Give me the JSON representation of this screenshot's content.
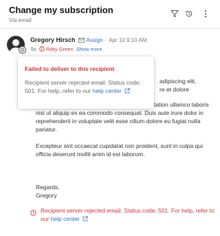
{
  "header": {
    "title": "Change my subscription",
    "subtitle": "Via email"
  },
  "message": {
    "sender": "Gregory Hirsch",
    "assign_label": "Assign",
    "separator": "·",
    "date": "Apr 10 9:10 AM",
    "to_label": "To:",
    "recipient": "Riley Green",
    "show_more": "Show more",
    "para1": "adipiscing elit,",
    "para1_line2": "re et dolore",
    "para2": "Ut enim ad minim veniam, quis nostrud exercitation ullamco laboris nisi ut aliquip ex ea commodo consequat. Duis aute irure dolor in reprehenderit in voluptate velit esse cillum dolore eu fugiat nulla pariatur.",
    "para3": "Excepteur sint occaecat cupidatat non proident, sunt in culpa qui officia deserunt mollit anim id est laborum.",
    "sig_line1": "Regards,",
    "sig_line2": "Gregory"
  },
  "error": {
    "text": "Recipient server rejected email. Status code: 501. For help, refer to our",
    "link": "help center"
  },
  "popover": {
    "title": "Failed to deliver to this recipient",
    "body": "Recipient server rejected email. Status code: 501. For help, refer to our",
    "link": "help center"
  },
  "colors": {
    "error": "#d32f2f",
    "link": "#2f6fd1"
  },
  "icons": [
    "filter-icon",
    "history-icon",
    "more-vertical-icon",
    "envelope-icon",
    "error-icon",
    "external-link-icon"
  ]
}
